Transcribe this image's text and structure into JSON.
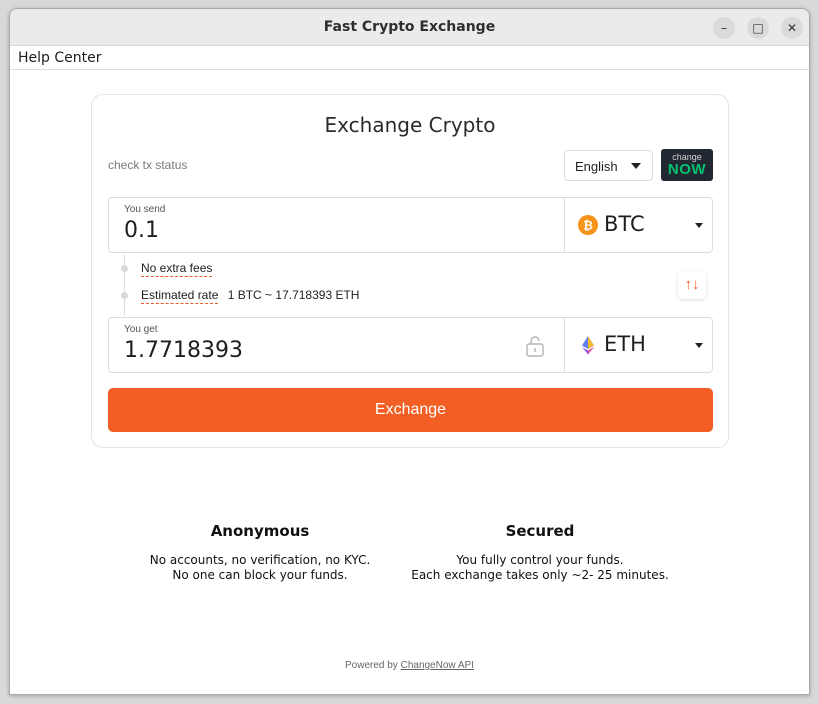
{
  "window": {
    "title": "Fast Crypto Exchange"
  },
  "menu": {
    "help_center": "Help Center"
  },
  "card": {
    "title": "Exchange Crypto",
    "check_tx_status": "check tx status",
    "language": "English",
    "logo": {
      "line1": "change",
      "line2": "NOW"
    }
  },
  "send": {
    "label": "You send",
    "value": "0.1",
    "coin": "BTC",
    "coin_icon": "bitcoin-icon",
    "coin_color": "#f7931a"
  },
  "info": {
    "no_fees": "No extra fees",
    "estimated_label": "Estimated rate",
    "rate": "1 BTC ~ 17.718393 ETH"
  },
  "receive": {
    "label": "You get",
    "value": "1.7718393",
    "coin": "ETH",
    "coin_icon": "ethereum-icon"
  },
  "exchange_button": "Exchange",
  "features": [
    {
      "heading": "Anonymous",
      "line1": "No accounts, no verification, no KYC.",
      "line2": "No one can block your funds."
    },
    {
      "heading": "Secured",
      "line1": "You fully control your funds.",
      "line2": "Each exchange takes only ~2- 25 minutes."
    }
  ],
  "footer": {
    "powered_by": "Powered by",
    "link": "ChangeNow API"
  },
  "colors": {
    "accent": "#f35e24",
    "logo_bg": "#222831",
    "logo_green": "#00c26f"
  }
}
